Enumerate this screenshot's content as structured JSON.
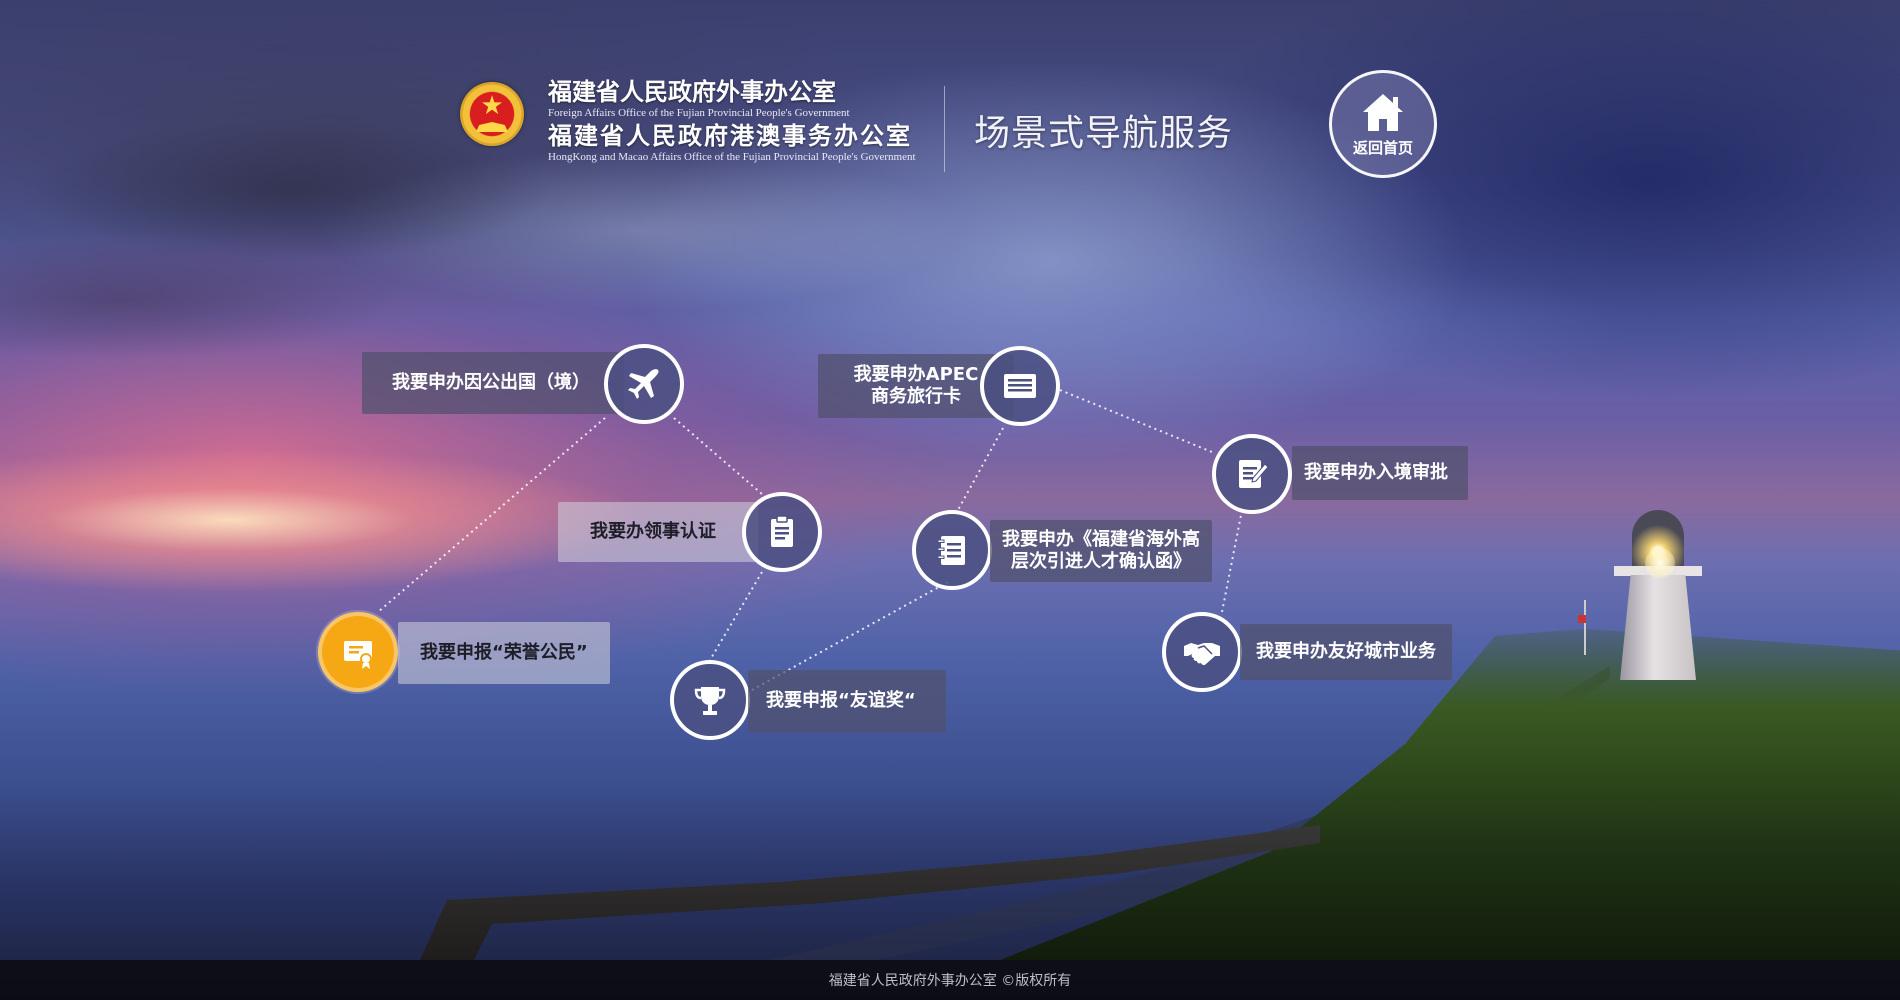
{
  "header": {
    "org_cn_1": "福建省人民政府外事办公室",
    "org_en_1": "Foreign Affairs Office of the Fujian Provincial People's Government",
    "org_cn_2": "福建省人民政府港澳事务办公室",
    "org_en_2": "HongKong and Macao Affairs Office of the Fujian Provincial People's Government",
    "service_title": "场景式导航服务",
    "home_label": "返回首页"
  },
  "nav": {
    "go_abroad": "我要申办因公出国（境）",
    "apec_line1": "我要申办APEC",
    "apec_line2": "商务旅行卡",
    "entry_approval": "我要申办入境审批",
    "consular": "我要办领事认证",
    "talent_line1": "我要申办《福建省海外高",
    "talent_line2": "层次引进人才确认函》",
    "honor_citizen": "我要申报“荣誉公民”",
    "friendship_award": "我要申报“友谊奖“",
    "friendly_city": "我要申办友好城市业务"
  },
  "icons": {
    "home": "home-icon",
    "go_abroad": "airplane-icon",
    "apec": "card-icon",
    "entry_approval": "document-pen-icon",
    "consular": "clipboard-icon",
    "talent": "notebook-icon",
    "honor_citizen": "certificate-icon",
    "friendship_award": "trophy-icon",
    "friendly_city": "handshake-icon"
  },
  "colors": {
    "active": "#f6a814",
    "label_bg": "#50506e"
  },
  "footer": {
    "copyright": "福建省人民政府外事办公室 ©版权所有"
  }
}
